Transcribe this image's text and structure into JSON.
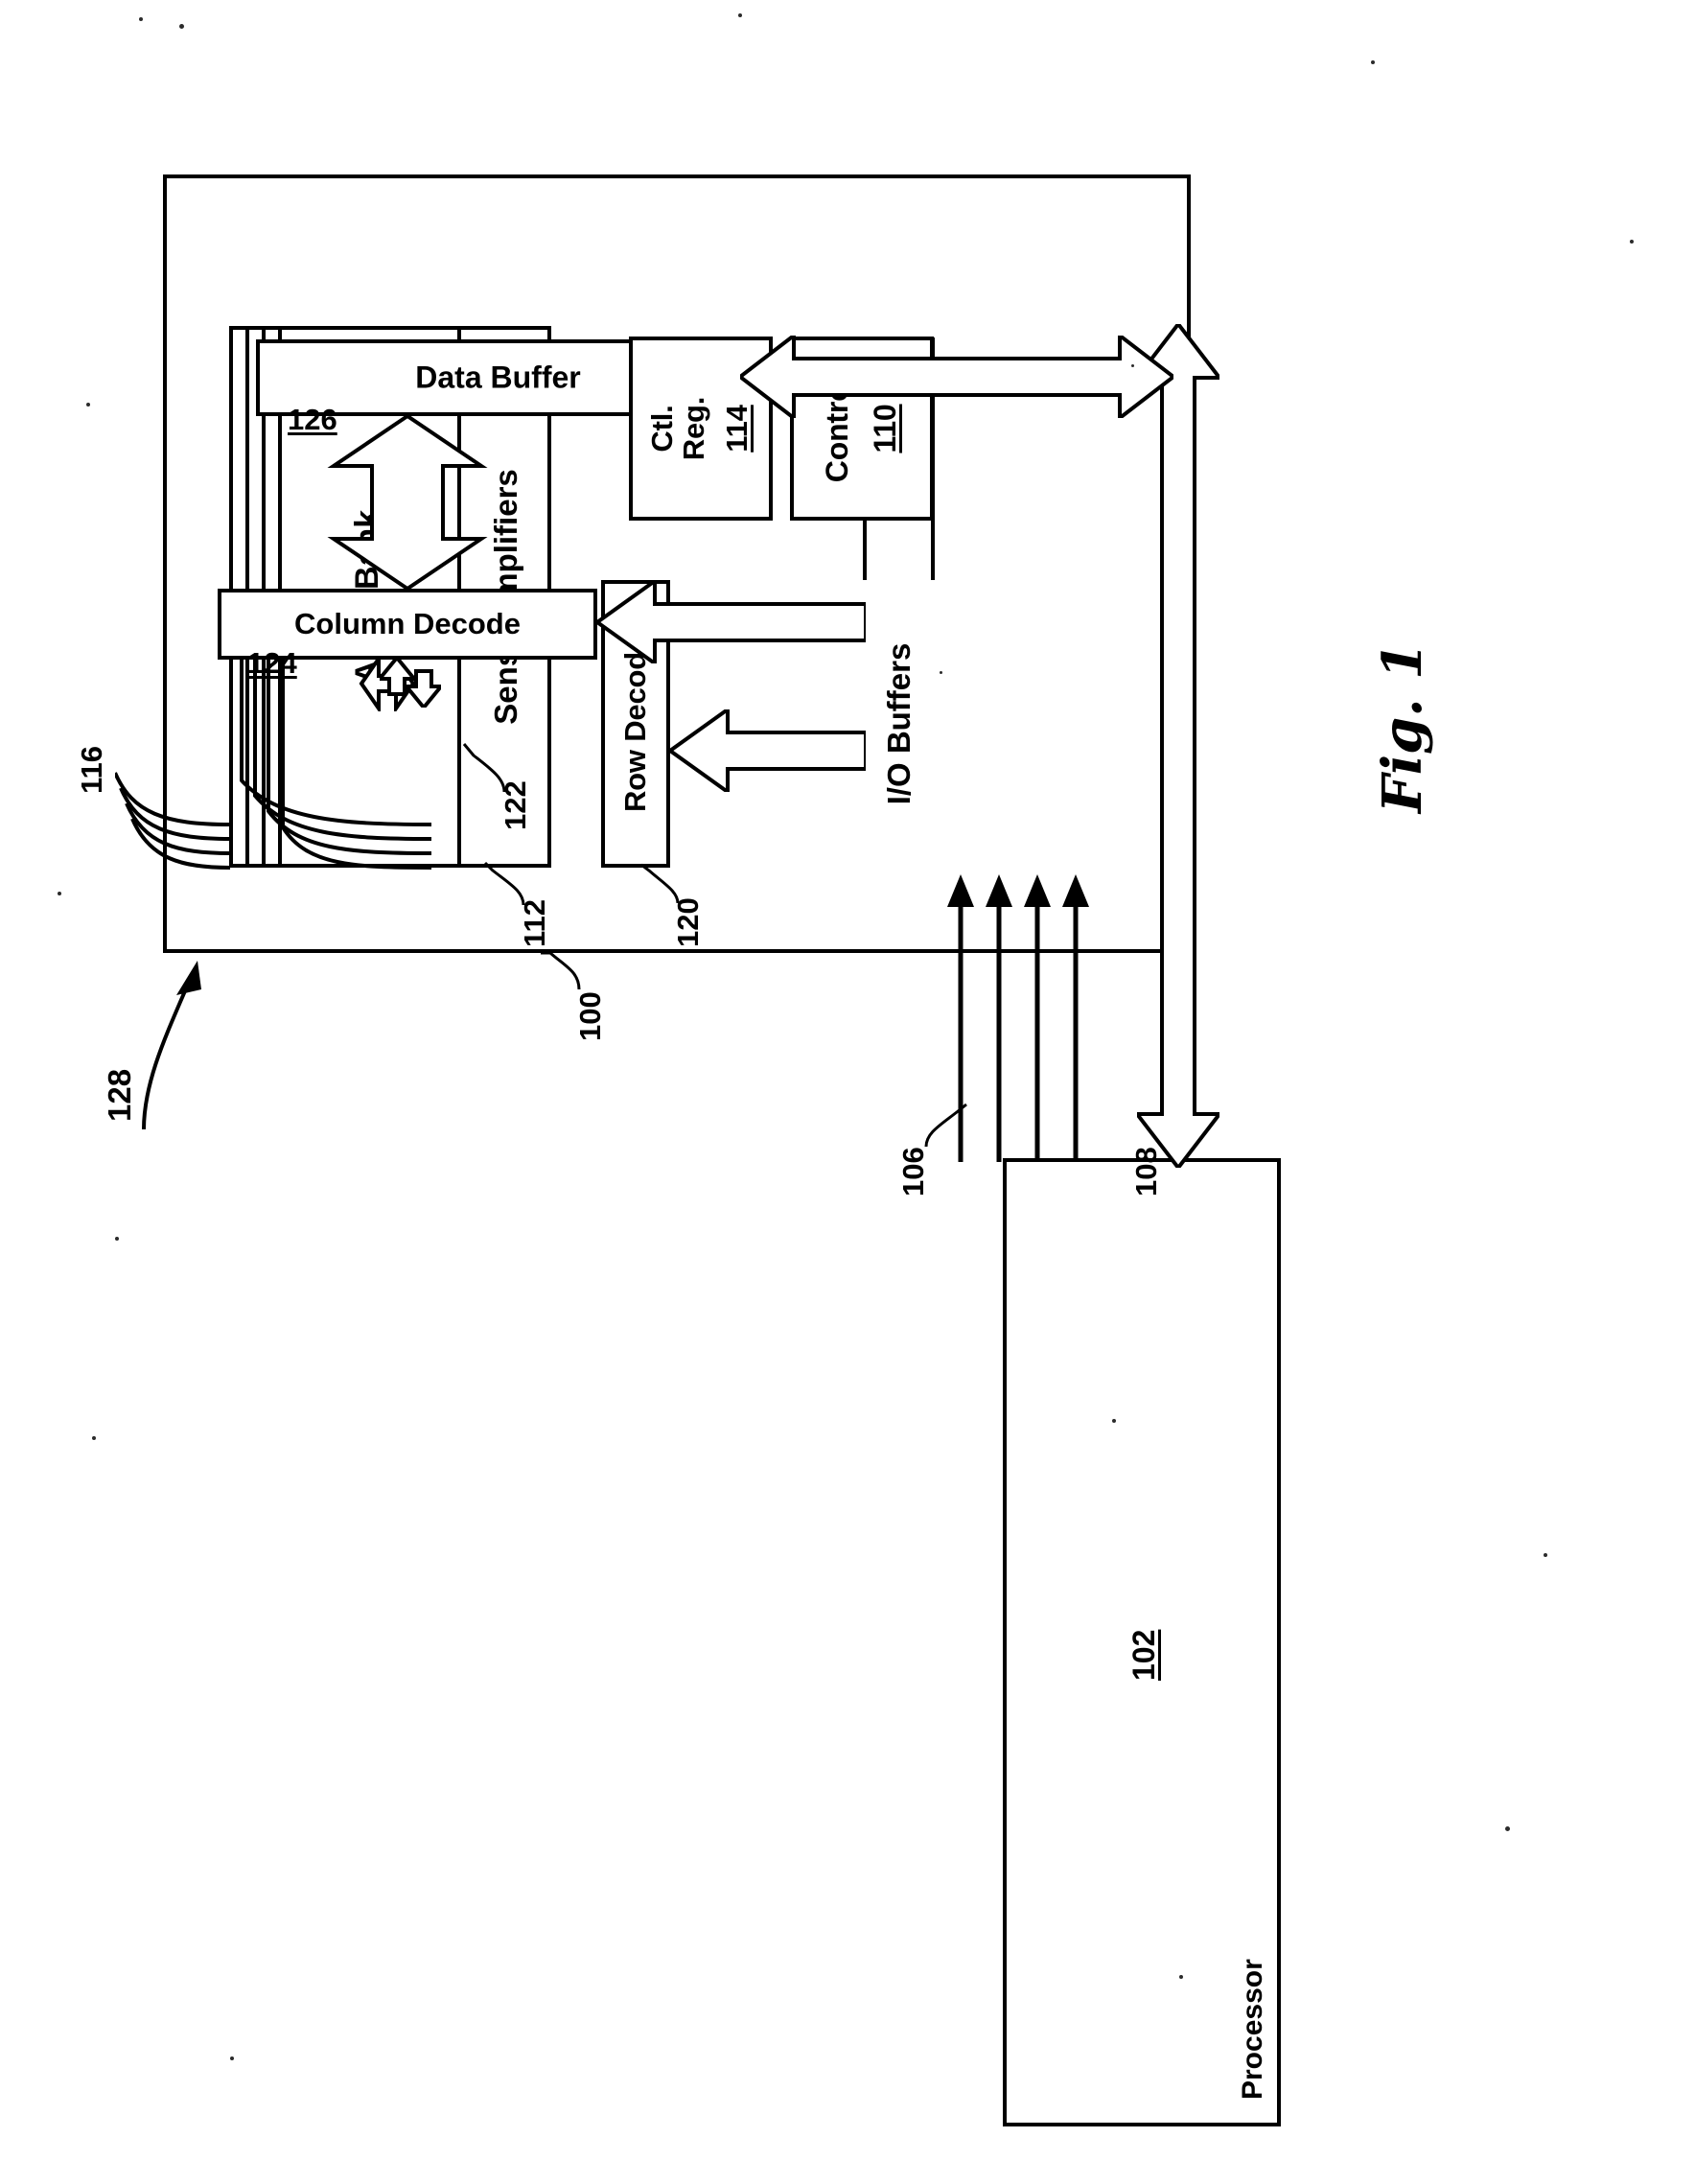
{
  "figure": {
    "caption": "Fig. 1",
    "system_ref": "128"
  },
  "processor": {
    "title": "Processor",
    "ref": "102"
  },
  "device": {
    "ref": "100"
  },
  "blocks": {
    "array_bank": {
      "label": "Array Bank",
      "ref": "112"
    },
    "sense_amplifiers": {
      "label": "Sense Amplifiers",
      "ref": "122"
    },
    "row_decode": {
      "label": "Row Decode",
      "ref": "120"
    },
    "column_decode": {
      "label": "Column Decode",
      "ref": "124"
    },
    "io_buffers": {
      "label": "I/O Buffers",
      "ref": ""
    },
    "control": {
      "label": "Control",
      "ref": "110"
    },
    "ctl_reg": {
      "label": "Ctl.\nReg.",
      "label_line1": "Ctl.",
      "label_line2": "Reg.",
      "ref": "114"
    },
    "data_buffer": {
      "label": "Data Buffer",
      "ref": "126"
    }
  },
  "buses": {
    "banks_ref": "116",
    "control_bus_ref": "106",
    "data_bus_ref": "108"
  },
  "colors": {
    "ink": "#000000",
    "paper": "#ffffff"
  }
}
